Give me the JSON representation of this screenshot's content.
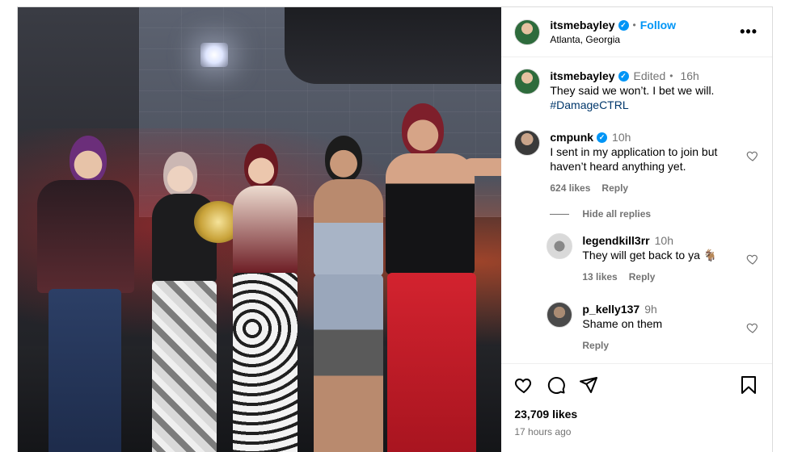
{
  "post": {
    "author": "itsmebayley",
    "follow_label": "Follow",
    "location": "Atlanta, Georgia",
    "more_label": "•••"
  },
  "caption": {
    "username": "itsmebayley",
    "edited": "Edited",
    "time": "16h",
    "text": "They said we won’t. I bet we will.",
    "hashtag": "#DamageCTRL"
  },
  "comments": [
    {
      "username": "cmpunk",
      "time": "10h",
      "text": "I sent in my application to join but haven’t heard anything yet.",
      "likes": "624 likes",
      "reply_label": "Reply"
    }
  ],
  "hide_replies_label": "Hide all replies",
  "replies": [
    {
      "username": "legendkill3rr",
      "time": "10h",
      "text": "They will get back to ya 🐐",
      "likes": "13 likes",
      "reply_label": "Reply"
    },
    {
      "username": "p_kelly137",
      "time": "9h",
      "text": "Shame on them",
      "reply_label": "Reply"
    }
  ],
  "footer": {
    "likes": "23,709 likes",
    "posted": "17 hours ago"
  },
  "icons": {
    "verified": "verified-badge-icon",
    "like": "heart-icon",
    "comment": "comment-bubble-icon",
    "share": "share-paper-plane-icon",
    "save": "bookmark-icon",
    "more": "more-options-icon"
  },
  "colors": {
    "accent": "#0095f6",
    "hashtag": "#00376b",
    "muted": "#737373",
    "border": "#dbdbdb"
  }
}
